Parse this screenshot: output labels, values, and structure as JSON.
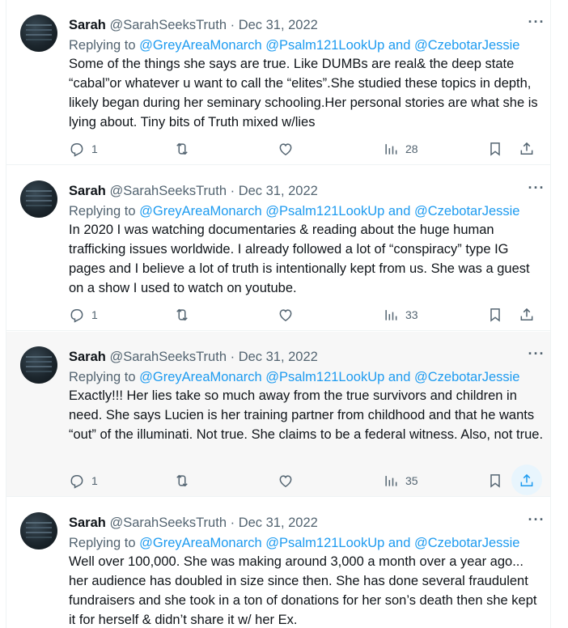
{
  "tweets": [
    {
      "name": "Sarah",
      "handle": "@SarahSeeksTruth",
      "dot": "·",
      "date": "Dec 31, 2022",
      "replying_prefix": "Replying to ",
      "mention1": "@GreyAreaMonarch",
      "mention2": "@Psalm121LookUp",
      "and": " and ",
      "mention3": "@CzebotarJessie",
      "text": "Some of the things she says are true. Like DUMBs are real& the deep state “cabal”or whatever u want to call the “elites”.She studied these topics in depth, likely began during her seminary schooling.Her personal stories are what she is lying about. Tiny bits of Truth mixed w/lies",
      "replies": "1",
      "views": "28",
      "more": "···"
    },
    {
      "name": "Sarah",
      "handle": "@SarahSeeksTruth",
      "dot": "·",
      "date": "Dec 31, 2022",
      "replying_prefix": "Replying to ",
      "mention1": "@GreyAreaMonarch",
      "mention2": "@Psalm121LookUp",
      "and": " and ",
      "mention3": "@CzebotarJessie",
      "text": "In 2020 I was watching documentaries & reading about the huge human trafficking issues worldwide. I already followed a lot of “conspiracy” type IG pages and I believe a lot of truth is intentionally kept from us. She was a guest on a show I used to watch on youtube.",
      "replies": "1",
      "views": "33",
      "more": "···"
    },
    {
      "name": "Sarah",
      "handle": "@SarahSeeksTruth",
      "dot": "·",
      "date": "Dec 31, 2022",
      "replying_prefix": "Replying to ",
      "mention1": "@GreyAreaMonarch",
      "mention2": "@Psalm121LookUp",
      "and": " and ",
      "mention3": "@CzebotarJessie",
      "text": "Exactly!!! Her lies take so much away from the true survivors and children in need. She says Lucien is her training partner from childhood and that he wants “out” of the illuminati. Not true. She claims to be a federal witness. Also, not true.",
      "replies": "1",
      "views": "35",
      "more": "···"
    },
    {
      "name": "Sarah",
      "handle": "@SarahSeeksTruth",
      "dot": "·",
      "date": "Dec 31, 2022",
      "replying_prefix": "Replying to ",
      "mention1": "@GreyAreaMonarch",
      "mention2": "@Psalm121LookUp",
      "and": " and ",
      "mention3": "@CzebotarJessie",
      "text": "Well over 100,000. She was making around 3,000 a month over a year ago...  her audience has doubled in size since then. She has done several fraudulent fundraisers and she took in a ton of donations for her son’s death then she kept it for herself & didn’t share it w/ her Ex.",
      "replies": "",
      "views": "",
      "more": "···"
    }
  ],
  "colors": {
    "accent": "#1d9bf0",
    "secondary_text": "#536471",
    "hover_bg": "#f7f7f7"
  }
}
